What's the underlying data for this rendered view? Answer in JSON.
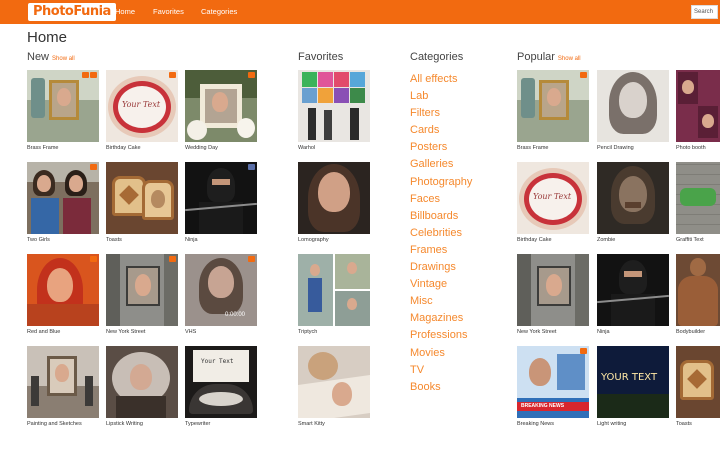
{
  "header": {
    "logo_part1": "Photo",
    "logo_part2": "Funia",
    "nav": [
      "Home",
      "Favorites",
      "Categories"
    ],
    "search_label": "Search"
  },
  "page_title": "Home",
  "sections": {
    "new": {
      "title": "New",
      "show_all": "Show all"
    },
    "favorites": {
      "title": "Favorites"
    },
    "categories": {
      "title": "Categories"
    },
    "popular": {
      "title": "Popular",
      "show_all": "Show all"
    }
  },
  "new_items": [
    {
      "label": "Brass Frame",
      "icon": "brass-frame-thumb"
    },
    {
      "label": "Birthday Cake",
      "icon": "birthday-cake-thumb"
    },
    {
      "label": "Wedding Day",
      "icon": "wedding-day-thumb"
    },
    {
      "label": "Two Girls",
      "icon": "two-girls-thumb"
    },
    {
      "label": "Toasts",
      "icon": "toasts-thumb"
    },
    {
      "label": "Ninja",
      "icon": "ninja-thumb"
    },
    {
      "label": "Red and Blue",
      "icon": "red-and-blue-thumb"
    },
    {
      "label": "New York Street",
      "icon": "new-york-street-thumb"
    },
    {
      "label": "VHS",
      "icon": "vhs-thumb"
    },
    {
      "label": "Painting and Sketches",
      "icon": "painting-thumb"
    },
    {
      "label": "Lipstick Writing",
      "icon": "lipstick-thumb"
    },
    {
      "label": "Typewriter",
      "icon": "typewriter-thumb"
    }
  ],
  "favorites_items": [
    {
      "label": "Warhol",
      "icon": "warhol-thumb"
    },
    {
      "label": "Lomography",
      "icon": "lomography-thumb"
    },
    {
      "label": "Triptych",
      "icon": "triptych-thumb"
    },
    {
      "label": "Smart Kitty",
      "icon": "smart-kitty-thumb"
    }
  ],
  "categories_list": [
    "All effects",
    "Lab",
    "Filters",
    "Cards",
    "Posters",
    "Galleries",
    "Photography",
    "Faces",
    "Billboards",
    "Celebrities",
    "Frames",
    "Drawings",
    "Vintage",
    "Misc",
    "Magazines",
    "Professions",
    "Movies",
    "TV",
    "Books"
  ],
  "popular_items": [
    {
      "label": "Brass Frame",
      "icon": "brass-frame-thumb"
    },
    {
      "label": "Pencil Drawing",
      "icon": "pencil-drawing-thumb"
    },
    {
      "label": "Photo booth",
      "icon": "photo-booth-thumb"
    },
    {
      "label": "Birthday Cake",
      "icon": "birthday-cake-thumb"
    },
    {
      "label": "Zombie",
      "icon": "zombie-thumb"
    },
    {
      "label": "Graffiti Text",
      "icon": "graffiti-text-thumb"
    },
    {
      "label": "New York Street",
      "icon": "new-york-street-thumb"
    },
    {
      "label": "Ninja",
      "icon": "ninja-thumb"
    },
    {
      "label": "Bodybuilder",
      "icon": "bodybuilder-thumb"
    },
    {
      "label": "Breaking News",
      "icon": "breaking-news-thumb"
    },
    {
      "label": "Light writing",
      "icon": "light-writing-thumb"
    },
    {
      "label": "Toasts",
      "icon": "toasts-thumb"
    }
  ],
  "thumb_text": {
    "cake_text": "Your Text",
    "typewriter_text": "Your Text",
    "light_text": "YOUR TEXT",
    "news_banner": "BREAKING NEWS",
    "vhs_time": "0:00:00"
  },
  "colors": {
    "accent": "#f26a10",
    "category_link": "#f5892e"
  }
}
